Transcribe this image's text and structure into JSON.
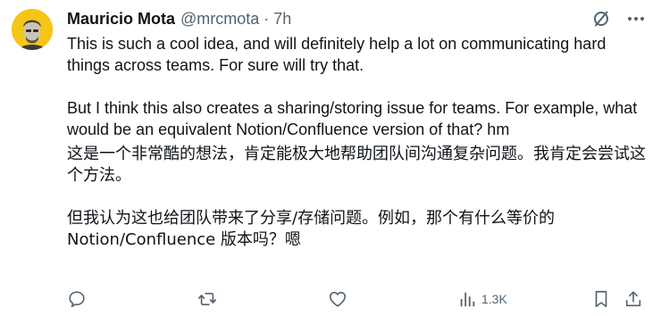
{
  "author": {
    "name": "Mauricio Mota",
    "handle": "@mrcmota",
    "separator": "·",
    "time": "7h"
  },
  "icons": {
    "avatar": "avatar-illustration",
    "grok": "slashed-circle-icon",
    "more": "more-dots-icon",
    "reply": "reply-icon",
    "retweet": "retweet-icon",
    "like": "heart-icon",
    "views": "bar-chart-icon",
    "bookmark": "bookmark-icon",
    "share": "share-icon"
  },
  "content": {
    "original_p1": "This is such a cool idea, and will definitely help a lot on communicating hard things across teams. For sure will try that.",
    "original_p2": "But I think this also creates a sharing/storing issue for teams. For example, what would be an equivalent Notion/Confluence version of that? hm",
    "translated_p1": "这是一个非常酷的想法，肯定能极大地帮助团队间沟通复杂问题。我肯定会尝试这个方法。",
    "translated_p2": "但我认为这也给团队带来了分享/存储问题。例如，那个有什么等价的 Notion/Confluence 版本吗？嗯"
  },
  "actions": {
    "views_count": "1.3K"
  },
  "colors": {
    "text": "#0f1419",
    "secondary": "#536471",
    "avatar_bg": "#f5c518"
  }
}
